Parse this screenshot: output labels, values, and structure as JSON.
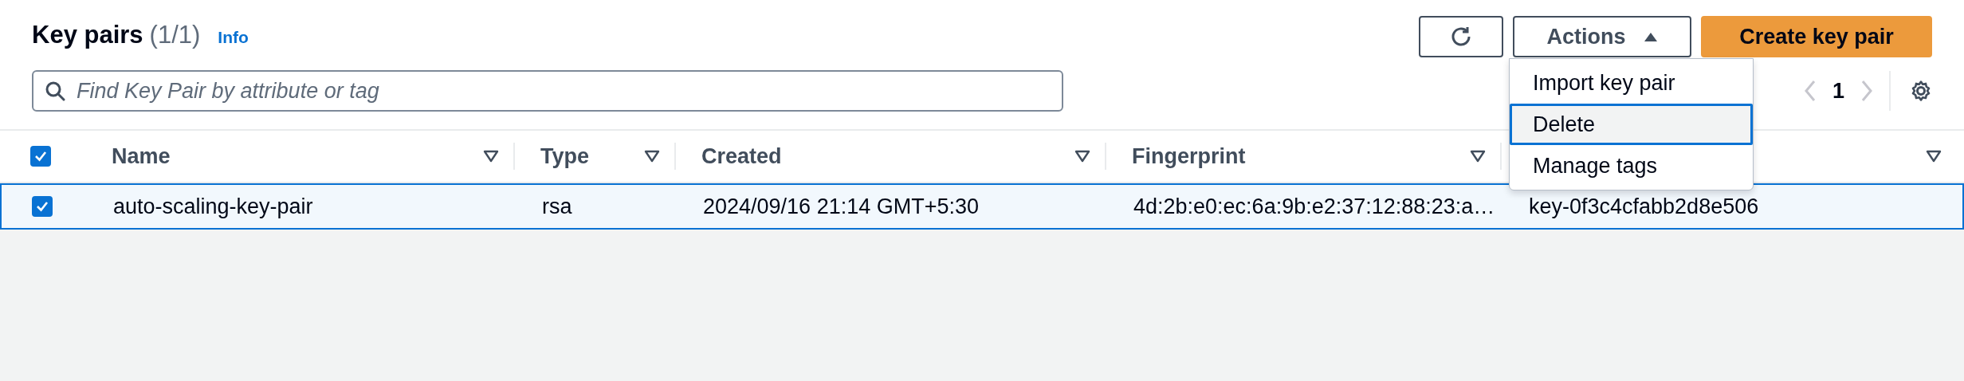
{
  "header": {
    "title": "Key pairs",
    "count": "(1/1)",
    "info_link": "Info"
  },
  "toolbar": {
    "buttons": [
      {
        "kind": "refresh"
      },
      {
        "kind": "dropdown",
        "label": "Actions",
        "expanded": true
      },
      {
        "kind": "primary",
        "label": "Create key pair"
      }
    ]
  },
  "search": {
    "placeholder": "Find Key Pair by attribute or tag"
  },
  "pagination": {
    "page": "1"
  },
  "actions_menu": {
    "items": [
      {
        "label": "Import key pair",
        "selected": false
      },
      {
        "label": "Delete",
        "selected": true
      },
      {
        "label": "Manage tags",
        "selected": false
      }
    ]
  },
  "table": {
    "select_all_checked": true,
    "columns": [
      {
        "label": "Name"
      },
      {
        "label": "Type"
      },
      {
        "label": "Created"
      },
      {
        "label": "Fingerprint"
      },
      {}
    ],
    "rows": [
      {
        "selected": true,
        "cells": [
          "auto-scaling-key-pair",
          "rsa",
          "2024/09/16 21:14 GMT+5:30",
          "4d:2b:e0:ec:6a:9b:e2:37:12:88:23:a…",
          "key-0f3c4cfabb2d8e506"
        ]
      }
    ]
  }
}
